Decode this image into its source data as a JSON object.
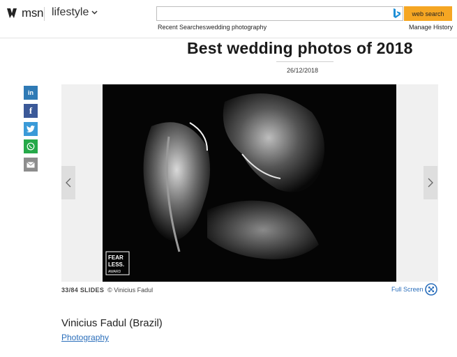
{
  "header": {
    "logo_text": "msn",
    "section": "lifestyle",
    "search": {
      "value": "",
      "placeholder": "",
      "button_label": "web search"
    },
    "recent_label": "Recent Searches:",
    "recent_items": [
      "wedding photography"
    ],
    "manage_history": "Manage History"
  },
  "article": {
    "title": "Best wedding photos of 2018",
    "date": "26/12/2018"
  },
  "share": [
    {
      "icon": "linkedin-icon",
      "glyph": "in"
    },
    {
      "icon": "facebook-icon",
      "glyph": "f"
    },
    {
      "icon": "twitter-icon",
      "glyph": ""
    },
    {
      "icon": "whatsapp-icon",
      "glyph": ""
    },
    {
      "icon": "email-icon",
      "glyph": ""
    }
  ],
  "slideshow": {
    "current": "33",
    "total": "84",
    "counter_label": "33/84 SLIDES",
    "credit": "© Vinicius Fadul",
    "fullscreen_label": "Full Screen",
    "watermark": "FEAR LESS AWARD",
    "caption_title": "Vinicius Fadul (Brazil)",
    "caption_link": "Photography"
  },
  "colors": {
    "accent_orange": "#f5a623",
    "link_blue": "#2a6ebb",
    "linkedin": "#2f7ab5",
    "facebook": "#3b5998",
    "twitter": "#3a9ad8",
    "whatsapp": "#25a949",
    "email": "#8d8d8d"
  }
}
